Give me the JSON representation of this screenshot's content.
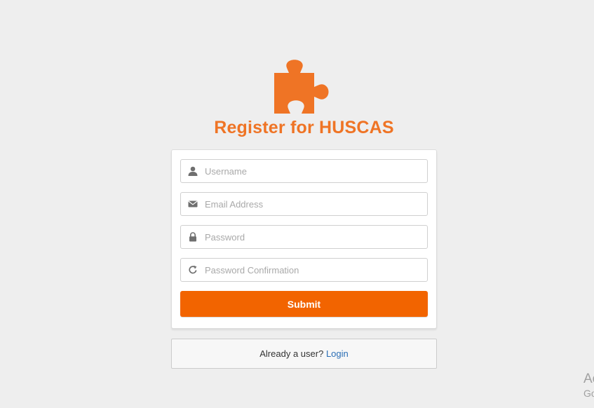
{
  "brand": {
    "title": "Register for HUSCAS",
    "accent_color": "#ef7425",
    "logo_icon": "puzzle-piece-icon"
  },
  "form": {
    "fields": [
      {
        "name": "username",
        "placeholder": "Username",
        "icon": "user-icon",
        "value": ""
      },
      {
        "name": "email",
        "placeholder": "Email Address",
        "icon": "envelope-icon",
        "value": ""
      },
      {
        "name": "password",
        "placeholder": "Password",
        "icon": "lock-icon",
        "value": ""
      },
      {
        "name": "password_confirmation",
        "placeholder": "Password Confirmation",
        "icon": "refresh-icon",
        "value": ""
      }
    ],
    "submit_label": "Submit",
    "submit_color": "#f26400"
  },
  "footer": {
    "prompt": "Already a user?",
    "link_label": "Login",
    "link_color": "#2a6eb5"
  },
  "watermark": {
    "line1": "Ac",
    "line2": "Go"
  }
}
